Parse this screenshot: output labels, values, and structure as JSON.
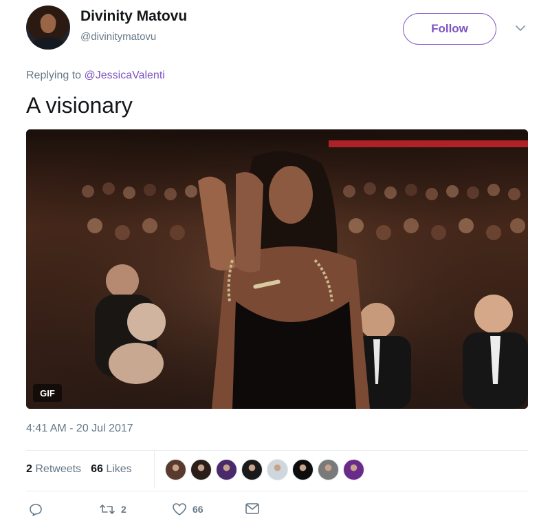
{
  "user": {
    "name": "Divinity Matovu",
    "handle": "@divinitymatovu"
  },
  "follow_label": "Follow",
  "reply": {
    "prefix": "Replying to ",
    "mention": "@JessicaValenti"
  },
  "tweet": {
    "text": "A visionary",
    "media_badge": "GIF",
    "timestamp": "4:41 AM - 20 Jul 2017"
  },
  "stats": {
    "retweets_count": "2",
    "retweets_label": "Retweets",
    "likes_count": "66",
    "likes_label": "Likes"
  },
  "likers": [
    {
      "icon": "liker-avatar-1",
      "color": "#5a3a2c"
    },
    {
      "icon": "liker-avatar-2",
      "color": "#2b1d17"
    },
    {
      "icon": "liker-avatar-3",
      "color": "#4a2a6a"
    },
    {
      "icon": "liker-avatar-4",
      "color": "#1a1a1a"
    },
    {
      "icon": "liker-avatar-5",
      "color": "#cfd6dc"
    },
    {
      "icon": "liker-avatar-6",
      "color": "#0d0d0d"
    },
    {
      "icon": "liker-avatar-7",
      "color": "#7a7a7a"
    },
    {
      "icon": "liker-avatar-8",
      "color": "#6a2a8a"
    }
  ],
  "actions": {
    "reply_icon": "reply-icon",
    "retweet_icon": "retweet-icon",
    "retweet_count": "2",
    "like_icon": "heart-icon",
    "like_count": "66",
    "dm_icon": "envelope-icon"
  },
  "colors": {
    "accent": "#7e54c2",
    "muted": "#657786",
    "text": "#14171a"
  }
}
